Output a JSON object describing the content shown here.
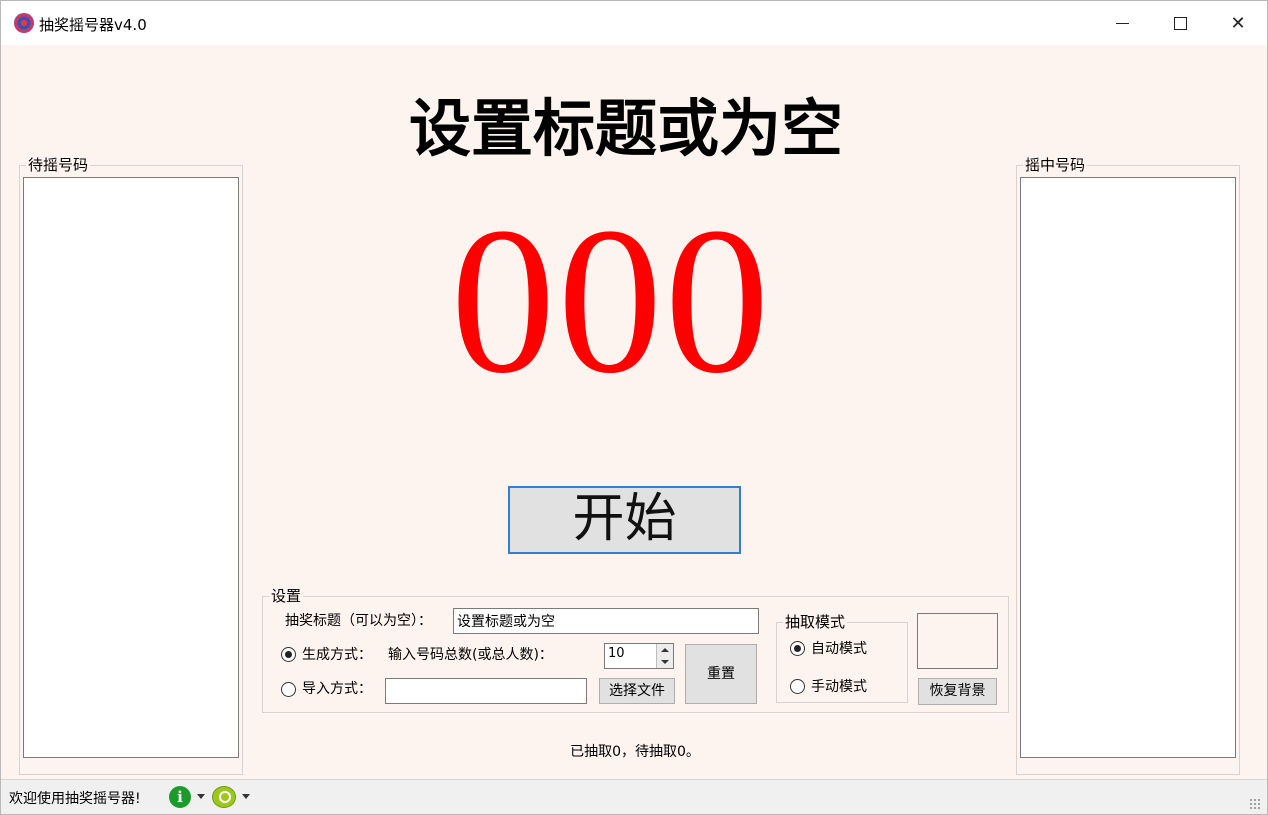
{
  "window": {
    "title": "抽奖摇号器v4.0",
    "app_icon": "lottery-app-icon",
    "controls": [
      "minimize",
      "maximize",
      "close"
    ]
  },
  "left_panel": {
    "label": "待摇号码",
    "items": []
  },
  "right_panel": {
    "label": "摇中号码",
    "items": []
  },
  "main": {
    "title": "设置标题或为空",
    "number": "000",
    "number_color": "#ff0000",
    "start_button": "开始"
  },
  "settings": {
    "label": "设置",
    "title_label": "抽奖标题（可以为空）：",
    "title_value": "设置标题或为空",
    "generate_label": "生成方式：",
    "generate_selected": true,
    "total_label": "输入号码总数(或总人数)：",
    "total_value": "10",
    "import_label": "导入方式：",
    "import_selected": false,
    "import_value": "",
    "choose_file_button": "选择文件",
    "reset_button": "重置",
    "mode_group": {
      "label": "抽取模式",
      "auto": "自动模式",
      "manual": "手动模式",
      "selected": "auto"
    },
    "restore_bg_button": "恢复背景"
  },
  "status_text": "已抽取0，待抽取0。",
  "statusbar": {
    "text": "欢迎使用抽奖摇号器!",
    "icons": [
      "info-icon",
      "search-icon"
    ]
  },
  "colors": {
    "background": "#fdf3ef",
    "accent": "#2f7fd7",
    "number": "#ff0000"
  }
}
